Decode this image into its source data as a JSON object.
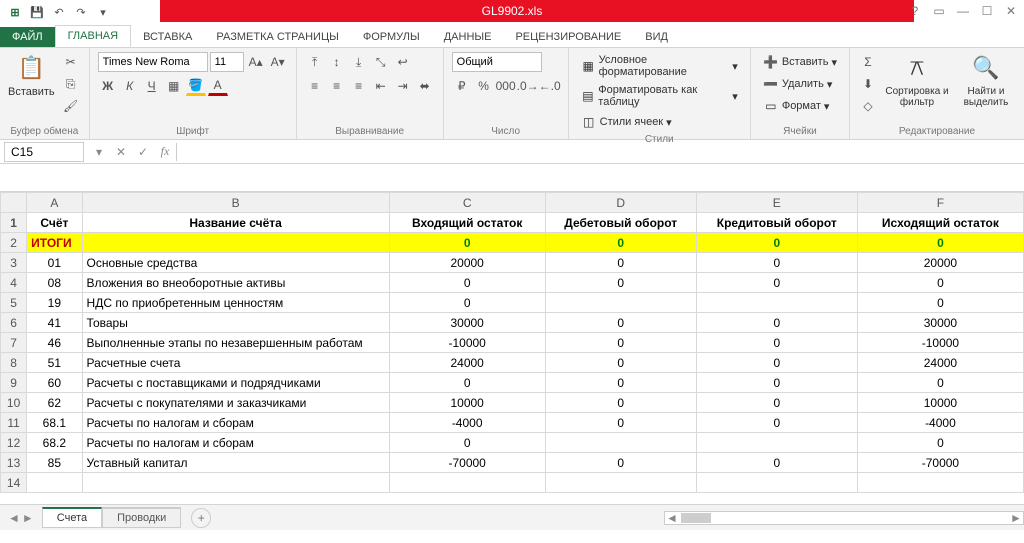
{
  "title": "GL9902.xls",
  "tabs": {
    "file": "ФАЙЛ",
    "home": "ГЛАВНАЯ",
    "insert": "ВСТАВКА",
    "layout": "РАЗМЕТКА СТРАНИЦЫ",
    "formulas": "ФОРМУЛЫ",
    "data": "ДАННЫЕ",
    "review": "РЕЦЕНЗИРОВАНИЕ",
    "view": "ВИД"
  },
  "ribbon": {
    "clipboard": {
      "paste": "Вставить",
      "label": "Буфер обмена"
    },
    "font": {
      "name": "Times New Roma",
      "size": "11",
      "label": "Шрифт"
    },
    "align": {
      "label": "Выравнивание"
    },
    "number": {
      "format": "Общий",
      "label": "Число"
    },
    "styles": {
      "cond": "Условное форматирование",
      "table": "Форматировать как таблицу",
      "cell": "Стили ячеек",
      "label": "Стили"
    },
    "cells": {
      "insert": "Вставить",
      "delete": "Удалить",
      "format": "Формат",
      "label": "Ячейки"
    },
    "editing": {
      "sort": "Сортировка и фильтр",
      "find": "Найти и выделить",
      "label": "Редактирование"
    }
  },
  "namebox": "C15",
  "columns": [
    "A",
    "B",
    "C",
    "D",
    "E",
    "F"
  ],
  "headers": {
    "A": "Счёт",
    "B": "Название счёта",
    "C": "Входящий остаток",
    "D": "Дебетовый оборот",
    "E": "Кредитовый оборот",
    "F": "Исходящий остаток"
  },
  "itogi": {
    "label": "ИТОГИ",
    "C": "0",
    "D": "0",
    "E": "0",
    "F": "0"
  },
  "rows": [
    {
      "n": 3,
      "A": "01",
      "B": "Основные средства",
      "C": "20000",
      "D": "0",
      "E": "0",
      "F": "20000"
    },
    {
      "n": 4,
      "A": "08",
      "B": "Вложения во внеоборотные активы",
      "C": "0",
      "D": "0",
      "E": "0",
      "F": "0"
    },
    {
      "n": 5,
      "A": "19",
      "B": "НДС по приобретенным ценностям",
      "C": "0",
      "D": "",
      "E": "",
      "F": "0"
    },
    {
      "n": 6,
      "A": "41",
      "B": "Товары",
      "C": "30000",
      "D": "0",
      "E": "0",
      "F": "30000"
    },
    {
      "n": 7,
      "A": "46",
      "B": "Выполненные этапы по незавершенным работам",
      "C": "-10000",
      "D": "0",
      "E": "0",
      "F": "-10000"
    },
    {
      "n": 8,
      "A": "51",
      "B": "Расчетные счета",
      "C": "24000",
      "D": "0",
      "E": "0",
      "F": "24000"
    },
    {
      "n": 9,
      "A": "60",
      "B": "Расчеты с поставщиками и подрядчиками",
      "C": "0",
      "D": "0",
      "E": "0",
      "F": "0"
    },
    {
      "n": 10,
      "A": "62",
      "B": "Расчеты с покупателями и заказчиками",
      "C": "10000",
      "D": "0",
      "E": "0",
      "F": "10000"
    },
    {
      "n": 11,
      "A": "68.1",
      "B": "Расчеты по налогам и сборам",
      "C": "-4000",
      "D": "0",
      "E": "0",
      "F": "-4000"
    },
    {
      "n": 12,
      "A": "68.2",
      "B": "Расчеты по налогам и сборам",
      "C": "0",
      "D": "",
      "E": "",
      "F": "0"
    },
    {
      "n": 13,
      "A": "85",
      "B": "Уставный капитал",
      "C": "-70000",
      "D": "0",
      "E": "0",
      "F": "-70000"
    }
  ],
  "sheets": {
    "active": "Счета",
    "other": "Проводки"
  }
}
